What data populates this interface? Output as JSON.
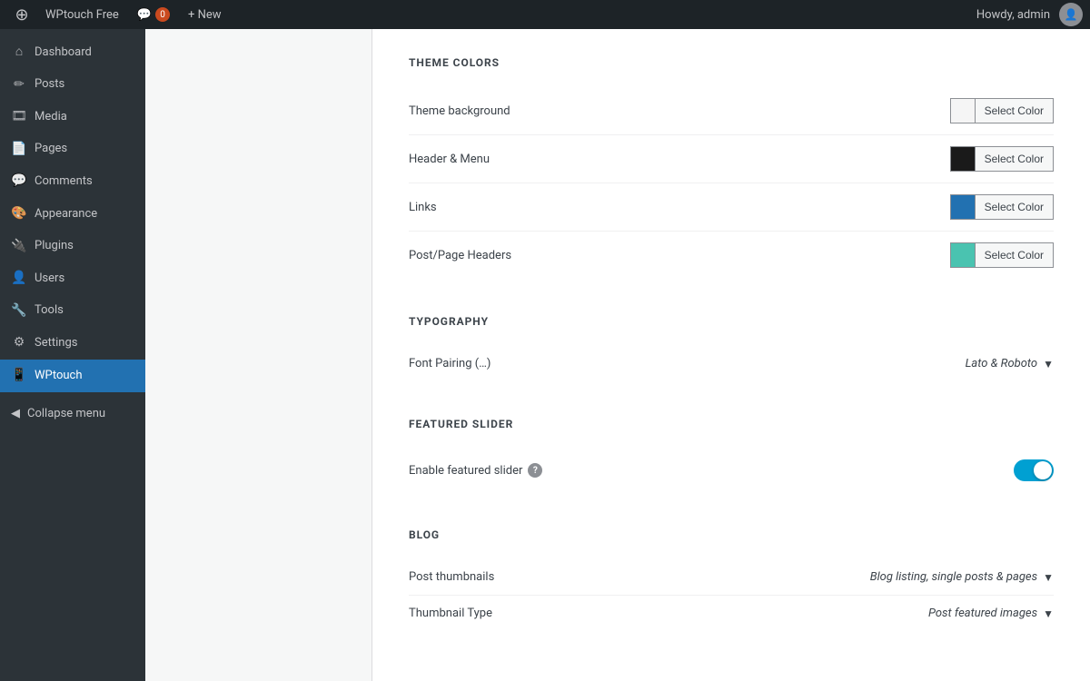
{
  "adminbar": {
    "logo": "⊕",
    "site_name": "WPtouch Free",
    "comments_label": "Comments",
    "comments_count": "0",
    "new_label": "+ New",
    "howdy": "Howdy, admin"
  },
  "sidebar": {
    "items": [
      {
        "id": "dashboard",
        "label": "Dashboard",
        "icon": "⌂"
      },
      {
        "id": "posts",
        "label": "Posts",
        "icon": "✏"
      },
      {
        "id": "media",
        "label": "Media",
        "icon": "🎞"
      },
      {
        "id": "pages",
        "label": "Pages",
        "icon": "📄"
      },
      {
        "id": "comments",
        "label": "Comments",
        "icon": "💬"
      },
      {
        "id": "appearance",
        "label": "Appearance",
        "icon": "🎨"
      },
      {
        "id": "plugins",
        "label": "Plugins",
        "icon": "🔌"
      },
      {
        "id": "users",
        "label": "Users",
        "icon": "👤"
      },
      {
        "id": "tools",
        "label": "Tools",
        "icon": "🔧"
      },
      {
        "id": "settings",
        "label": "Settings",
        "icon": "⚙"
      },
      {
        "id": "wptouch",
        "label": "WPtouch",
        "icon": "📱"
      }
    ],
    "collapse_label": "Collapse menu",
    "collapse_icon": "◀"
  },
  "content": {
    "theme_colors": {
      "title": "THEME COLORS",
      "rows": [
        {
          "id": "theme-bg",
          "label": "Theme background",
          "color": "#f5f5f5",
          "btn": "Select Color"
        },
        {
          "id": "header-menu",
          "label": "Header & Menu",
          "color": "#1a1a1a",
          "btn": "Select Color"
        },
        {
          "id": "links",
          "label": "Links",
          "color": "#2271b1",
          "btn": "Select Color"
        },
        {
          "id": "post-page-headers",
          "label": "Post/Page Headers",
          "color": "#4ac3b0",
          "btn": "Select Color"
        }
      ]
    },
    "typography": {
      "title": "TYPOGRAPHY",
      "rows": [
        {
          "id": "font-pairing",
          "label": "Font Pairing (…)",
          "value": "Lato & Roboto"
        }
      ]
    },
    "featured_slider": {
      "title": "FEATURED SLIDER",
      "rows": [
        {
          "id": "enable-slider",
          "label": "Enable featured slider",
          "has_help": true,
          "enabled": true
        }
      ]
    },
    "blog": {
      "title": "BLOG",
      "rows": [
        {
          "id": "post-thumbnails",
          "label": "Post thumbnails",
          "value": "Blog listing, single posts & pages"
        },
        {
          "id": "thumbnail-type",
          "label": "Thumbnail Type",
          "value": "Post featured images"
        }
      ]
    }
  }
}
